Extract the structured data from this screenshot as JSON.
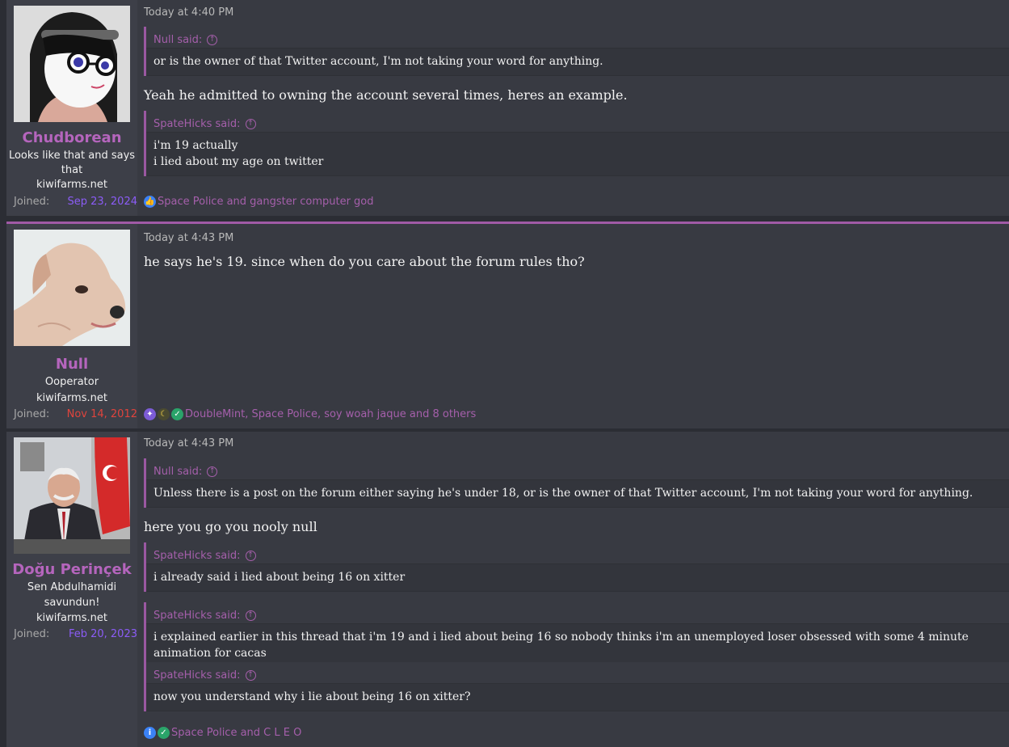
{
  "posts": [
    {
      "user": {
        "name": "Chudborean",
        "title_lines": [
          "Looks like that and says",
          "that",
          "kiwifarms.net"
        ],
        "joined_label": "Joined:",
        "joined_date": "Sep 23, 2024",
        "joined_color": "#8b5cf6"
      },
      "time": "Today at 4:40 PM",
      "quotes": [
        {
          "author": "Null said:",
          "lines": [
            "or is the owner of that Twitter account, I'm not taking your word for anything."
          ]
        },
        {
          "author": "SpateHicks said:",
          "lines": [
            "i'm 19 actually",
            "i lied about my age on twitter"
          ]
        }
      ],
      "message": "Yeah he admitted to owning the account several times, heres an example.",
      "reactions": "Space Police and gangster computer god"
    },
    {
      "user": {
        "name": "Null",
        "title_lines": [
          "Ooperator",
          "kiwifarms.net"
        ],
        "joined_label": "Joined:",
        "joined_date": "Nov 14, 2012",
        "joined_color": "#e0443d"
      },
      "time": "Today at 4:43 PM",
      "message": "he says he's 19. since when do you care about the forum rules tho?",
      "reactions": "DoubleMint, Space Police, soy woah jaque and 8 others"
    },
    {
      "user": {
        "name": "Doğu Perinçek",
        "title_lines": [
          "Sen Abdulhamidi",
          "savundun!",
          "kiwifarms.net"
        ],
        "joined_label": "Joined:",
        "joined_date": "Feb 20, 2023",
        "joined_color": "#8b5cf6"
      },
      "time": "Today at 4:43 PM",
      "quotes": [
        {
          "author": "Null said:",
          "lines": [
            "Unless there is a post on the forum either saying he's under 18, or is the owner of that Twitter account, I'm not taking your word for anything."
          ]
        },
        {
          "author": "SpateHicks said:",
          "lines": [
            "i already said i lied about being 16 on xitter"
          ]
        },
        {
          "author": "SpateHicks said:",
          "lines": [
            "i explained earlier in this thread that i'm 19 and i lied about being 16 so nobody thinks i'm an unemployed loser obsessed with some 4 minute animation for cacas"
          ]
        },
        {
          "author": "SpateHicks said:",
          "lines": [
            "now you understand why i lie about being 16 on xitter?"
          ]
        }
      ],
      "message": "here you go you nooly null",
      "reactions": "Space Police and C L E O"
    }
  ]
}
